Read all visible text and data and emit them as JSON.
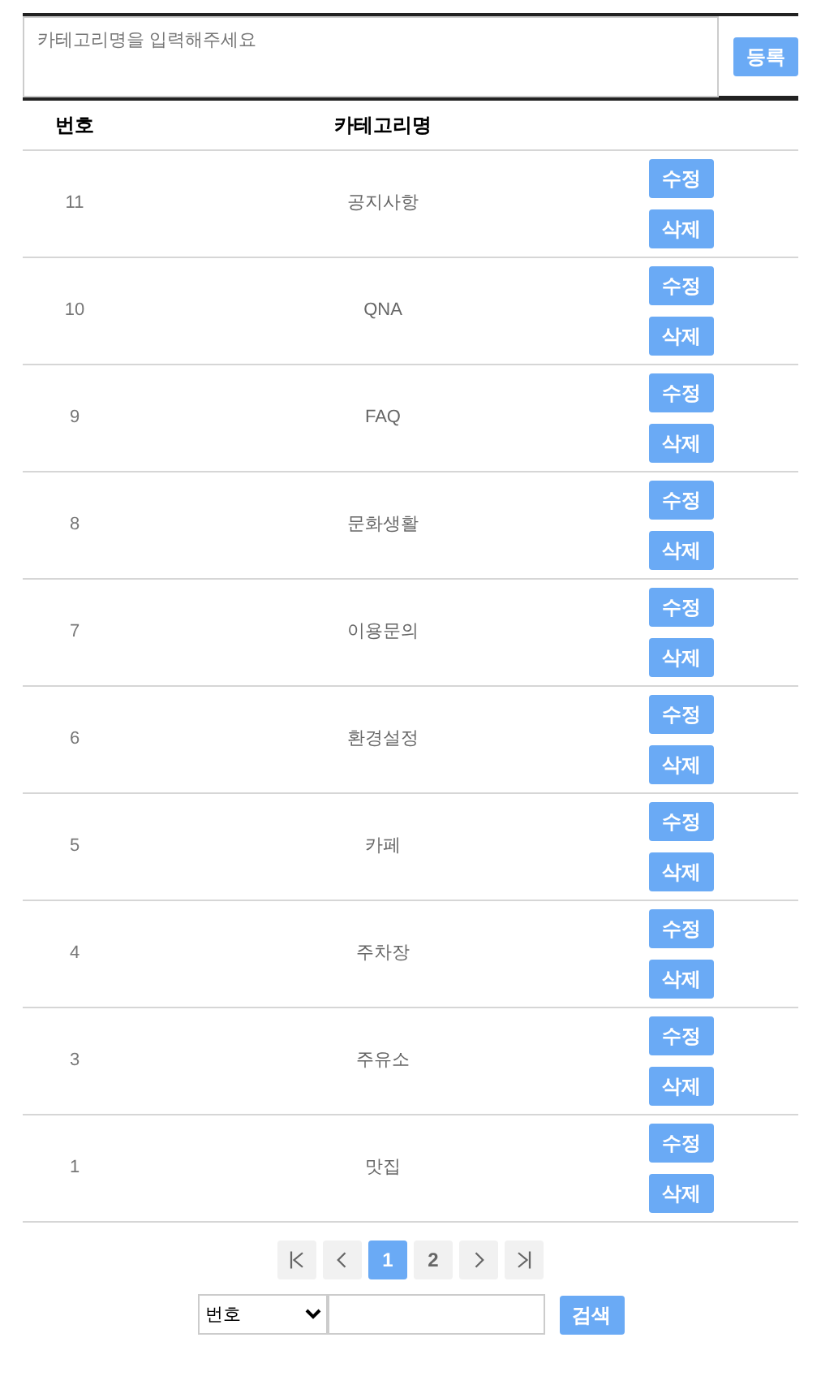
{
  "form": {
    "placeholder": "카테고리명을 입력해주세요",
    "submit": "등록"
  },
  "table": {
    "columns": [
      "번호",
      "카테고리명"
    ],
    "rows": [
      {
        "no": "11",
        "name": "공지사항",
        "edit": "수정",
        "delete": "삭제"
      },
      {
        "no": "10",
        "name": "QNA",
        "edit": "수정",
        "delete": "삭제"
      },
      {
        "no": "9",
        "name": "FAQ",
        "edit": "수정",
        "delete": "삭제"
      },
      {
        "no": "8",
        "name": "문화생활",
        "edit": "수정",
        "delete": "삭제"
      },
      {
        "no": "7",
        "name": "이용문의",
        "edit": "수정",
        "delete": "삭제"
      },
      {
        "no": "6",
        "name": "환경설정",
        "edit": "수정",
        "delete": "삭제"
      },
      {
        "no": "5",
        "name": "카페",
        "edit": "수정",
        "delete": "삭제"
      },
      {
        "no": "4",
        "name": "주차장",
        "edit": "수정",
        "delete": "삭제"
      },
      {
        "no": "3",
        "name": "주유소",
        "edit": "수정",
        "delete": "삭제"
      },
      {
        "no": "1",
        "name": "맛집",
        "edit": "수정",
        "delete": "삭제"
      }
    ]
  },
  "pagination": [
    {
      "kind": "first"
    },
    {
      "kind": "prev"
    },
    {
      "kind": "page",
      "label": "1",
      "selected": true
    },
    {
      "kind": "page",
      "label": "2",
      "selected": false
    },
    {
      "kind": "next"
    },
    {
      "kind": "last"
    }
  ],
  "search": {
    "field": "번호",
    "button": "검색"
  }
}
